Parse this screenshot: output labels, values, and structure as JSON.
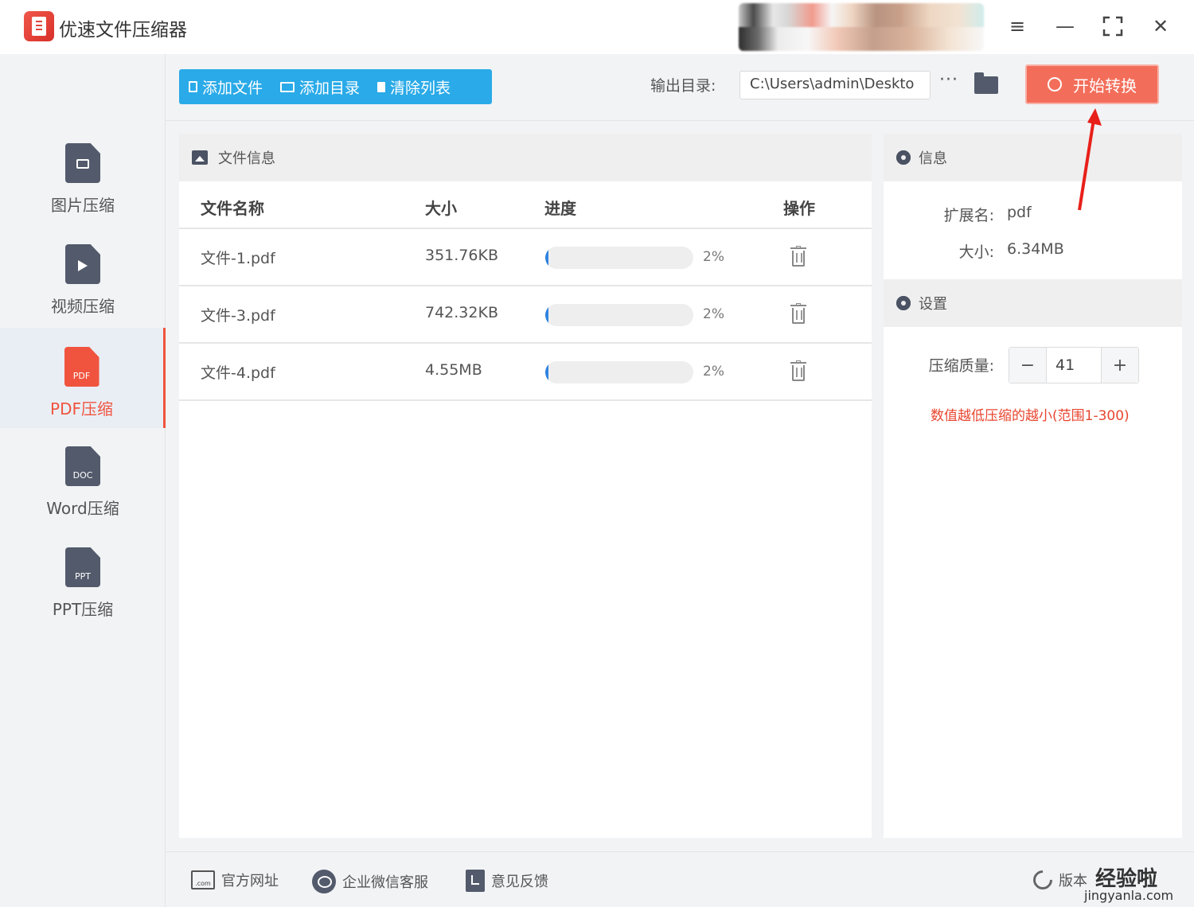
{
  "app": {
    "title": "优速文件压缩器"
  },
  "window_controls": {
    "menu_icon": "menu-icon",
    "minimize_icon": "minimize-icon",
    "maximize_icon": "fullscreen-icon",
    "close_icon": "close-icon"
  },
  "sidebar": {
    "items": [
      {
        "label": "图片压缩",
        "icon": "image-file-icon",
        "tag": ""
      },
      {
        "label": "视频压缩",
        "icon": "video-file-icon",
        "tag": ""
      },
      {
        "label": "PDF压缩",
        "icon": "pdf-file-icon",
        "tag": "PDF",
        "active": true
      },
      {
        "label": "Word压缩",
        "icon": "doc-file-icon",
        "tag": "DOC"
      },
      {
        "label": "PPT压缩",
        "icon": "ppt-file-icon",
        "tag": "PPT"
      }
    ]
  },
  "toolbar": {
    "add_file": "添加文件",
    "add_dir": "添加目录",
    "clear_list": "清除列表",
    "output_label": "输出目录:",
    "output_path": "C:\\Users\\admin\\Deskto",
    "more": "···",
    "start": "开始转换"
  },
  "file_panel": {
    "title": "文件信息",
    "columns": {
      "name": "文件名称",
      "size": "大小",
      "progress": "进度",
      "action": "操作"
    },
    "rows": [
      {
        "name": "文件-1.pdf",
        "size": "351.76KB",
        "progress": 0.02,
        "progress_text": "2%"
      },
      {
        "name": "文件-3.pdf",
        "size": "742.32KB",
        "progress": 0.02,
        "progress_text": "2%"
      },
      {
        "name": "文件-4.pdf",
        "size": "4.55MB",
        "progress": 0.02,
        "progress_text": "2%"
      }
    ]
  },
  "info_panel": {
    "title": "信息",
    "ext_label": "扩展名:",
    "ext_value": "pdf",
    "size_label": "大小:",
    "size_value": "6.34MB"
  },
  "settings_panel": {
    "title": "设置",
    "quality_label": "压缩质量:",
    "quality_value": "41",
    "minus": "−",
    "plus": "+",
    "hint": "数值越低压缩的越小(范围1-300)"
  },
  "footer": {
    "website": "官方网址",
    "wechat": "企业微信客服",
    "feedback": "意见反馈",
    "version": "版本"
  },
  "watermark": {
    "text": "经验啦",
    "url_text": "jingyanla.com"
  },
  "colors": {
    "accent_blue": "#2aaae8",
    "accent_orange": "#f0543f",
    "start_button": "#f36e5a",
    "progress_fill": "#2f83e0"
  }
}
